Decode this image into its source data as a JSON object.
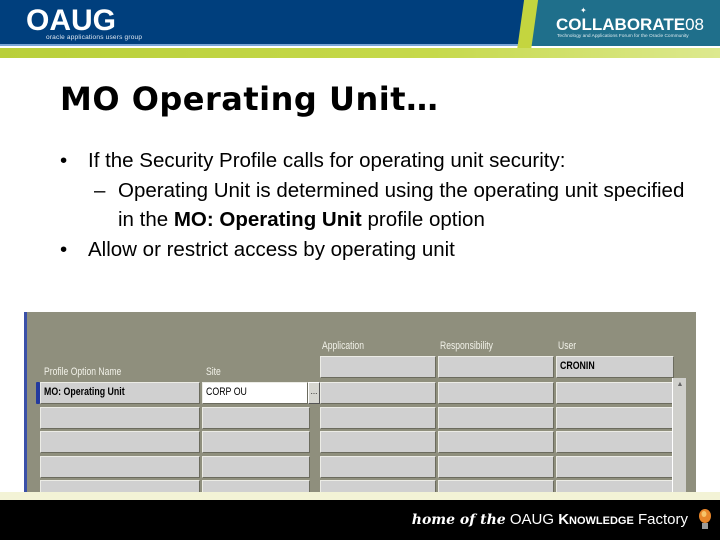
{
  "header": {
    "left_logo": "OAUG",
    "left_tagline": "oracle applications users group",
    "right_logo_main": "COLLABORATE",
    "right_logo_year": "08",
    "right_tagline": "Technology and Applications Forum for the Oracle Community"
  },
  "slide": {
    "title": "MO Operating Unit…",
    "bullets": [
      {
        "text": "If the Security Profile calls for operating unit security:",
        "sub": {
          "prefix": "Operating Unit is determined using the operating unit specified in the ",
          "bold": "MO: Operating Unit",
          "suffix": " profile option"
        }
      },
      {
        "text": "Allow or restrict access by operating unit"
      }
    ]
  },
  "form": {
    "columns": {
      "profile_option_name": "Profile Option Name",
      "site": "Site",
      "application": "Application",
      "responsibility": "Responsibility",
      "user": "User"
    },
    "header_row_user_value": "CRONIN",
    "rows": [
      {
        "profile_option_name": "MO: Operating Unit",
        "site": "CORP OU",
        "application": "",
        "responsibility": "",
        "user": ""
      },
      {
        "profile_option_name": "",
        "site": "",
        "application": "",
        "responsibility": "",
        "user": ""
      },
      {
        "profile_option_name": "",
        "site": "",
        "application": "",
        "responsibility": "",
        "user": ""
      },
      {
        "profile_option_name": "",
        "site": "",
        "application": "",
        "responsibility": "",
        "user": ""
      },
      {
        "profile_option_name": "",
        "site": "",
        "application": "",
        "responsibility": "",
        "user": ""
      }
    ],
    "lov_button_label": "...",
    "scroll_up_glyph": "▲"
  },
  "footer": {
    "script_text": "home of the",
    "brand": "OAUG",
    "knowledge": "Knowledge",
    "factory": "Factory"
  },
  "colors": {
    "banner_blue": "#003f7d",
    "banner_teal": "#1f6f8b",
    "banner_green": "#b9cf3a",
    "form_bg": "#8f8f7d",
    "cell_bg": "#d0d0d0"
  }
}
